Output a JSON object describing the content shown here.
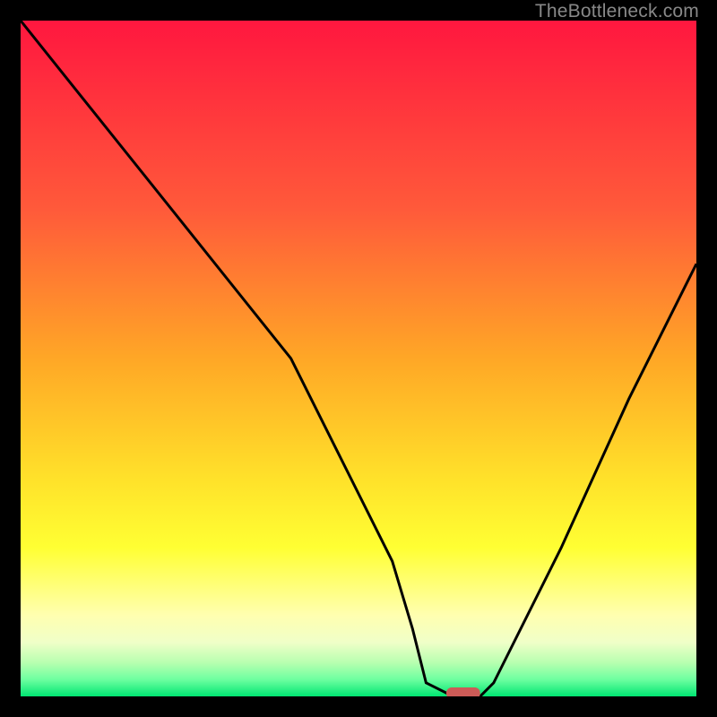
{
  "attribution": "TheBottleneck.com",
  "colors": {
    "red": "#ff173f",
    "orange": "#ffa726",
    "yellow": "#ffef2a",
    "yellowgreen": "#d8ff5a",
    "been_green": "#9dff7e",
    "green": "#00e672",
    "black": "#000000",
    "curve": "#000000",
    "marker": "#cc5b57"
  },
  "chart_data": {
    "type": "line",
    "title": "",
    "xlabel": "",
    "ylabel": "",
    "xlim": [
      0,
      100
    ],
    "ylim": [
      0,
      100
    ],
    "series": [
      {
        "name": "bottleneck-curve",
        "x": [
          0,
          8,
          24,
          40,
          55,
          58,
          60,
          64,
          68,
          70,
          80,
          90,
          100
        ],
        "values": [
          100,
          90,
          70,
          50,
          20,
          10,
          2,
          0,
          0,
          2,
          22,
          44,
          64
        ]
      }
    ],
    "marker": {
      "x_start": 63,
      "x_end": 68,
      "y": 0
    },
    "gradient_stops": [
      {
        "offset": 0.0,
        "color": "#ff173f"
      },
      {
        "offset": 0.28,
        "color": "#ff5a3a"
      },
      {
        "offset": 0.5,
        "color": "#ffa726"
      },
      {
        "offset": 0.68,
        "color": "#ffe22a"
      },
      {
        "offset": 0.78,
        "color": "#ffff33"
      },
      {
        "offset": 0.88,
        "color": "#ffffb0"
      },
      {
        "offset": 0.92,
        "color": "#f0ffc8"
      },
      {
        "offset": 0.95,
        "color": "#b8ffb0"
      },
      {
        "offset": 0.975,
        "color": "#6effa0"
      },
      {
        "offset": 1.0,
        "color": "#00e672"
      }
    ]
  }
}
